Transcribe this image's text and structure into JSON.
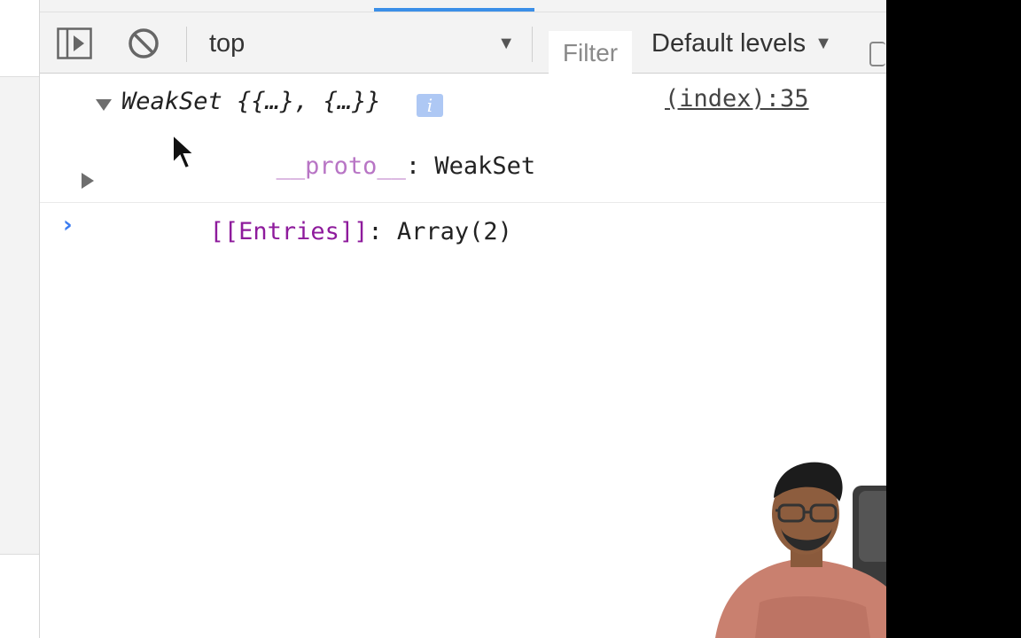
{
  "toolbar": {
    "context_label": "top",
    "filter_placeholder": "Filter",
    "levels_label": "Default levels"
  },
  "console": {
    "message": {
      "summary": "WeakSet {{…}, {…}}",
      "info_badge": "i",
      "source": "(index):35",
      "properties": [
        {
          "key": "__proto__",
          "separator": ": ",
          "value": "WeakSet"
        },
        {
          "key": "[[Entries]]",
          "separator": ": ",
          "value": "Array(2)"
        }
      ]
    },
    "prompt_symbol": "›"
  },
  "colors": {
    "accent": "#3b8fe8",
    "proto_key": "#b875c5",
    "entries_key": "#8e1b9c",
    "prompt": "#3b7cf0",
    "info_badge": "#aec8f4"
  },
  "icons": {
    "sidebar_toggle": "sidebar-toggle-icon",
    "clear": "clear-console-icon",
    "dropdown": "dropdown-arrow-icon",
    "expand_down": "triangle-down-icon",
    "expand_right": "triangle-right-icon",
    "cursor": "mouse-cursor-icon"
  }
}
